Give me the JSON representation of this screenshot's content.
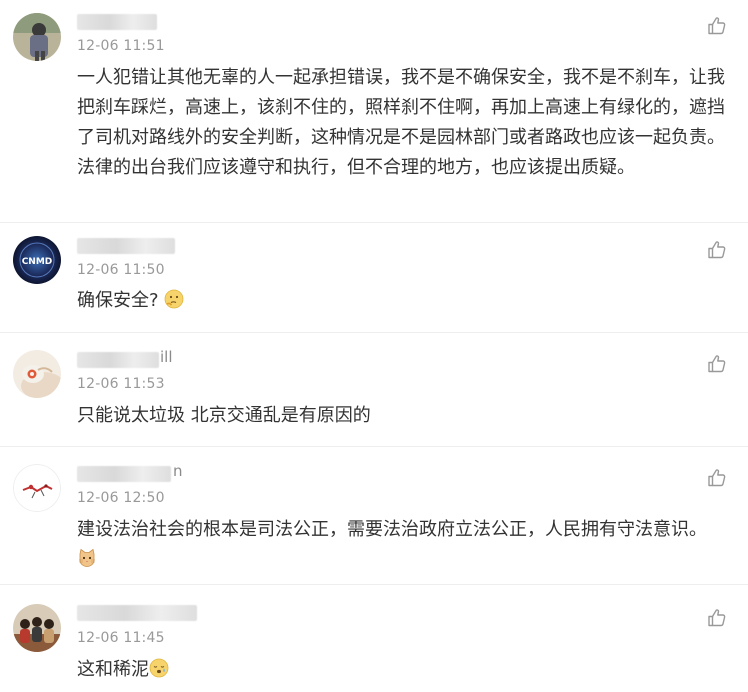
{
  "comments": [
    {
      "name_visible": "",
      "time": "12-06 11:51",
      "text": "一人犯错让其他无辜的人一起承担错误，我不是不确保安全，我不是不刹车，让我把刹车踩烂，高速上，该刹不住的，照样刹不住啊，再加上高速上有绿化的，遮挡了司机对路线外的安全判断，这种情况是不是园林部门或者路政也应该一起负责。法律的出台我们应该遵守和执行，但不合理的地方，也应该提出质疑。",
      "like_icon": "thumbs-up-icon"
    },
    {
      "name_visible": "",
      "avatar_text": "CNMD",
      "time": "12-06 11:50",
      "text": "确保安全?",
      "emoji": "thinking-face-emoji",
      "like_icon": "thumbs-up-icon"
    },
    {
      "name_visible": "ill",
      "time": "12-06 11:53",
      "text": "只能说太垃圾 北京交通乱是有原因的",
      "like_icon": "thumbs-up-icon"
    },
    {
      "name_visible": "n",
      "time": "12-06 12:50",
      "text": "建设法治社会的根本是司法公正，需要法治政府立法公正，人民拥有守法意识。",
      "emoji": "cat-face-emoji",
      "like_icon": "thumbs-up-icon"
    },
    {
      "name_visible": "",
      "time": "12-06 11:45",
      "text": "这和稀泥",
      "emoji": "sleepy-face-emoji",
      "like_icon": "thumbs-up-icon"
    }
  ]
}
